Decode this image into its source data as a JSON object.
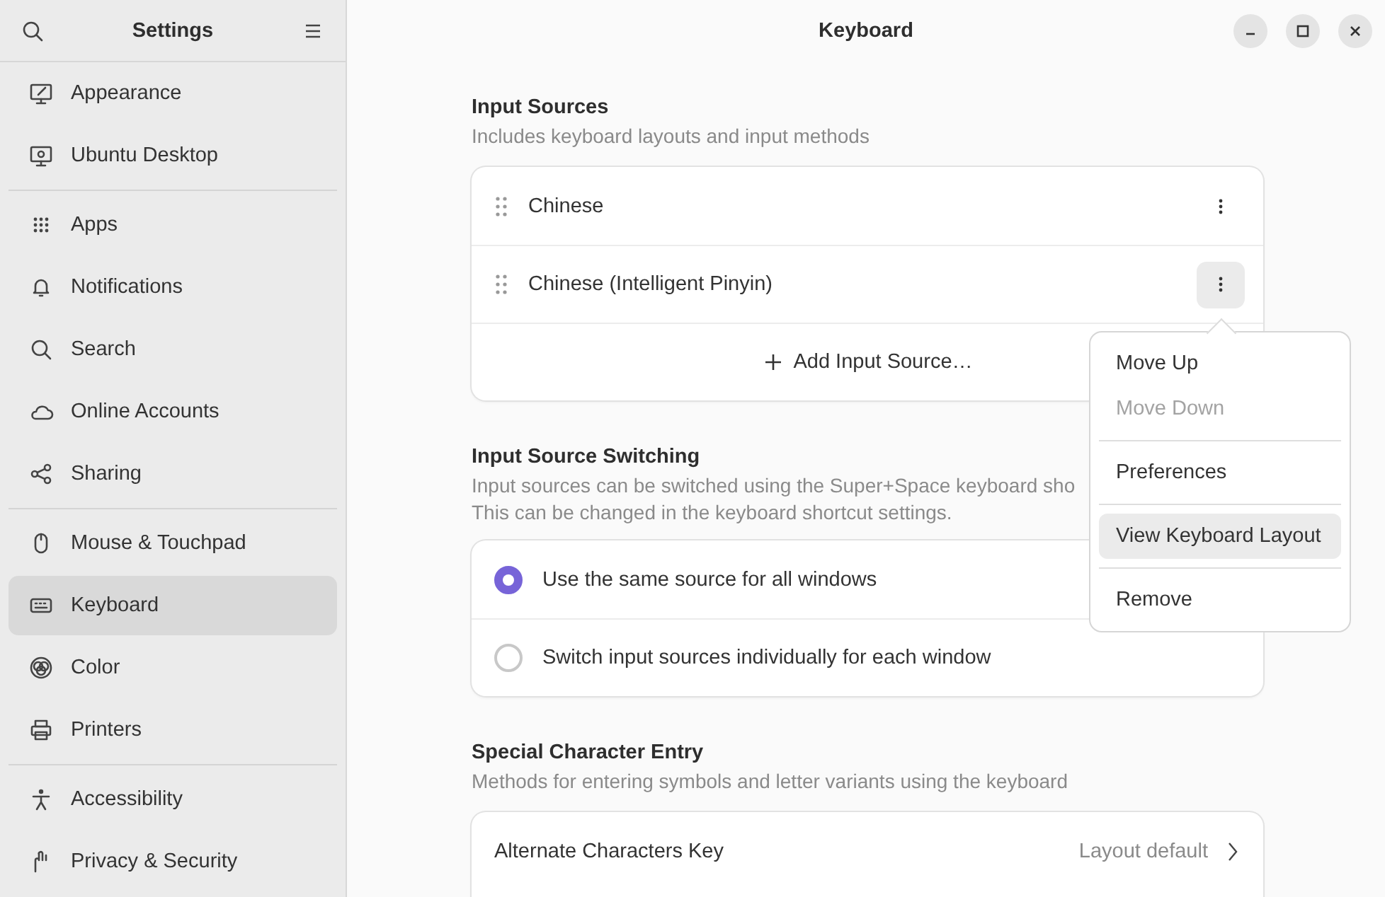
{
  "sidebar": {
    "title": "Settings",
    "groups": [
      [
        {
          "label": "Appearance",
          "selected": false
        },
        {
          "label": "Ubuntu Desktop",
          "selected": false
        }
      ],
      [
        {
          "label": "Apps",
          "selected": false
        },
        {
          "label": "Notifications",
          "selected": false
        },
        {
          "label": "Search",
          "selected": false
        },
        {
          "label": "Online Accounts",
          "selected": false
        },
        {
          "label": "Sharing",
          "selected": false
        }
      ],
      [
        {
          "label": "Mouse & Touchpad",
          "selected": false
        },
        {
          "label": "Keyboard",
          "selected": true
        },
        {
          "label": "Color",
          "selected": false
        },
        {
          "label": "Printers",
          "selected": false
        }
      ],
      [
        {
          "label": "Accessibility",
          "selected": false
        },
        {
          "label": "Privacy & Security",
          "selected": false
        }
      ]
    ]
  },
  "window": {
    "title": "Keyboard"
  },
  "input_sources": {
    "title": "Input Sources",
    "subtitle": "Includes keyboard layouts and input methods",
    "sources": [
      {
        "name": "Chinese",
        "menu_open": false
      },
      {
        "name": "Chinese (Intelligent Pinyin)",
        "menu_open": true
      }
    ],
    "add_label": "Add Input Source…"
  },
  "switching": {
    "title": "Input Source Switching",
    "description_lines": [
      "Input sources can be switched using the Super+Space keyboard sho",
      "This can be changed in the keyboard shortcut settings."
    ],
    "options": [
      {
        "label": "Use the same source for all windows",
        "selected": true
      },
      {
        "label": "Switch input sources individually for each window",
        "selected": false
      }
    ]
  },
  "special": {
    "title": "Special Character Entry",
    "subtitle": "Methods for entering symbols and letter variants using the keyboard",
    "rows": [
      {
        "label": "Alternate Characters Key",
        "value": "Layout default"
      }
    ]
  },
  "menu": {
    "groups": [
      [
        {
          "label": "Move Up",
          "disabled": false,
          "highlighted": false
        },
        {
          "label": "Move Down",
          "disabled": true,
          "highlighted": false
        }
      ],
      [
        {
          "label": "Preferences",
          "disabled": false,
          "highlighted": false
        }
      ],
      [
        {
          "label": "View Keyboard Layout",
          "disabled": false,
          "highlighted": true
        }
      ],
      [
        {
          "label": "Remove",
          "disabled": false,
          "highlighted": false
        }
      ]
    ]
  }
}
